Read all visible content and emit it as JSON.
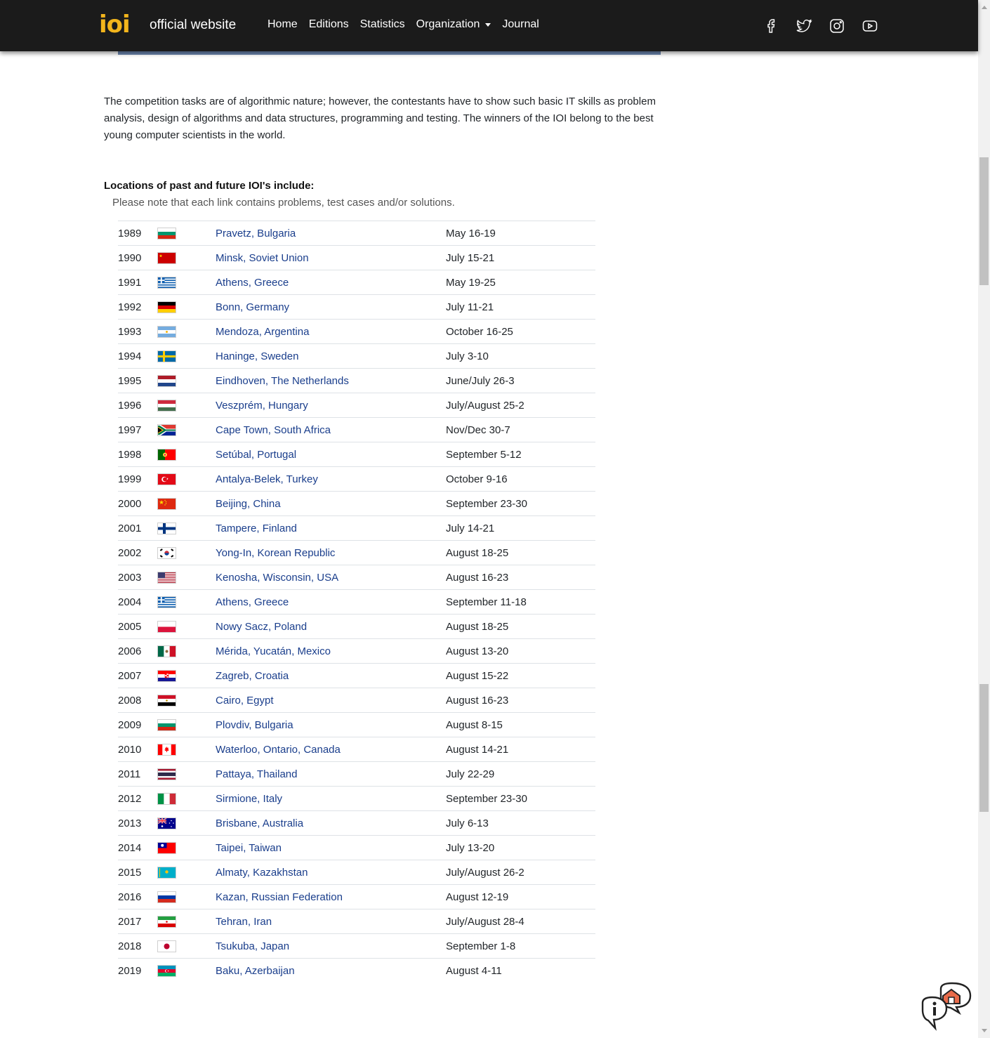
{
  "navbar": {
    "logo_text": "ioi",
    "brand_text": "official website",
    "links": [
      {
        "label": "Home"
      },
      {
        "label": "Editions"
      },
      {
        "label": "Statistics"
      },
      {
        "label": "Organization",
        "dropdown": true
      },
      {
        "label": "Journal"
      }
    ],
    "social_icons": [
      "facebook-icon",
      "twitter-icon",
      "instagram-icon",
      "youtube-icon"
    ]
  },
  "intro_text": "The competition tasks are of algorithmic nature; however, the contestants have to show such basic IT skills as problem analysis, design of algorithms and data structures, programming and testing. The winners of the IOI belong to the best young computer scientists in the world.",
  "locations": {
    "heading": "Locations of past and future IOI's include:",
    "note": "Please note that each link contains problems, test cases and/or solutions.",
    "rows": [
      {
        "year": "1989",
        "location": "Pravetz, Bulgaria",
        "dates": "May 16-19",
        "flag": "bulgaria"
      },
      {
        "year": "1990",
        "location": "Minsk, Soviet Union",
        "dates": "July 15-21",
        "flag": "soviet-union"
      },
      {
        "year": "1991",
        "location": "Athens, Greece",
        "dates": "May 19-25",
        "flag": "greece"
      },
      {
        "year": "1992",
        "location": "Bonn, Germany",
        "dates": "July 11-21",
        "flag": "germany"
      },
      {
        "year": "1993",
        "location": "Mendoza, Argentina",
        "dates": "October 16-25",
        "flag": "argentina"
      },
      {
        "year": "1994",
        "location": "Haninge, Sweden",
        "dates": "July 3-10",
        "flag": "sweden"
      },
      {
        "year": "1995",
        "location": "Eindhoven, The Netherlands",
        "dates": "June/July 26-3",
        "flag": "netherlands"
      },
      {
        "year": "1996",
        "location": "Veszprém, Hungary",
        "dates": "July/August 25-2",
        "flag": "hungary"
      },
      {
        "year": "1997",
        "location": "Cape Town, South Africa",
        "dates": "Nov/Dec 30-7",
        "flag": "south-africa"
      },
      {
        "year": "1998",
        "location": "Setúbal, Portugal",
        "dates": "September 5-12",
        "flag": "portugal"
      },
      {
        "year": "1999",
        "location": "Antalya-Belek, Turkey",
        "dates": "October 9-16",
        "flag": "turkey"
      },
      {
        "year": "2000",
        "location": "Beijing, China",
        "dates": "September 23-30",
        "flag": "china"
      },
      {
        "year": "2001",
        "location": "Tampere, Finland",
        "dates": "July 14-21",
        "flag": "finland"
      },
      {
        "year": "2002",
        "location": "Yong-In, Korean Republic",
        "dates": "August 18-25",
        "flag": "korea"
      },
      {
        "year": "2003",
        "location": "Kenosha, Wisconsin, USA",
        "dates": "August 16-23",
        "flag": "usa"
      },
      {
        "year": "2004",
        "location": "Athens, Greece",
        "dates": "September 11-18",
        "flag": "greece"
      },
      {
        "year": "2005",
        "location": "Nowy Sacz, Poland",
        "dates": "August 18-25",
        "flag": "poland"
      },
      {
        "year": "2006",
        "location": "Mérida, Yucatán, Mexico",
        "dates": "August 13-20",
        "flag": "mexico"
      },
      {
        "year": "2007",
        "location": "Zagreb, Croatia",
        "dates": "August 15-22",
        "flag": "croatia"
      },
      {
        "year": "2008",
        "location": "Cairo, Egypt",
        "dates": "August 16-23",
        "flag": "egypt"
      },
      {
        "year": "2009",
        "location": "Plovdiv, Bulgaria",
        "dates": "August 8-15",
        "flag": "bulgaria"
      },
      {
        "year": "2010",
        "location": "Waterloo, Ontario, Canada",
        "dates": "August 14-21",
        "flag": "canada"
      },
      {
        "year": "2011",
        "location": "Pattaya, Thailand",
        "dates": "July 22-29",
        "flag": "thailand"
      },
      {
        "year": "2012",
        "location": "Sirmione, Italy",
        "dates": "September 23-30",
        "flag": "italy"
      },
      {
        "year": "2013",
        "location": "Brisbane, Australia",
        "dates": "July 6-13",
        "flag": "australia"
      },
      {
        "year": "2014",
        "location": "Taipei, Taiwan",
        "dates": "July 13-20",
        "flag": "taiwan"
      },
      {
        "year": "2015",
        "location": "Almaty, Kazakhstan",
        "dates": "July/August 26-2",
        "flag": "kazakhstan"
      },
      {
        "year": "2016",
        "location": "Kazan, Russian Federation",
        "dates": "August 12-19",
        "flag": "russia"
      },
      {
        "year": "2017",
        "location": "Tehran, Iran",
        "dates": "July/August 28-4",
        "flag": "iran"
      },
      {
        "year": "2018",
        "location": "Tsukuba, Japan",
        "dates": "September 1-8",
        "flag": "japan"
      },
      {
        "year": "2019",
        "location": "Baku, Azerbaijan",
        "dates": "August 4-11",
        "flag": "azerbaijan"
      }
    ]
  },
  "colors": {
    "navbar_bg": "#1b1b1b",
    "logo": "#f3b51c",
    "link": "#1a3e8c",
    "row_border": "#dee2e6"
  }
}
